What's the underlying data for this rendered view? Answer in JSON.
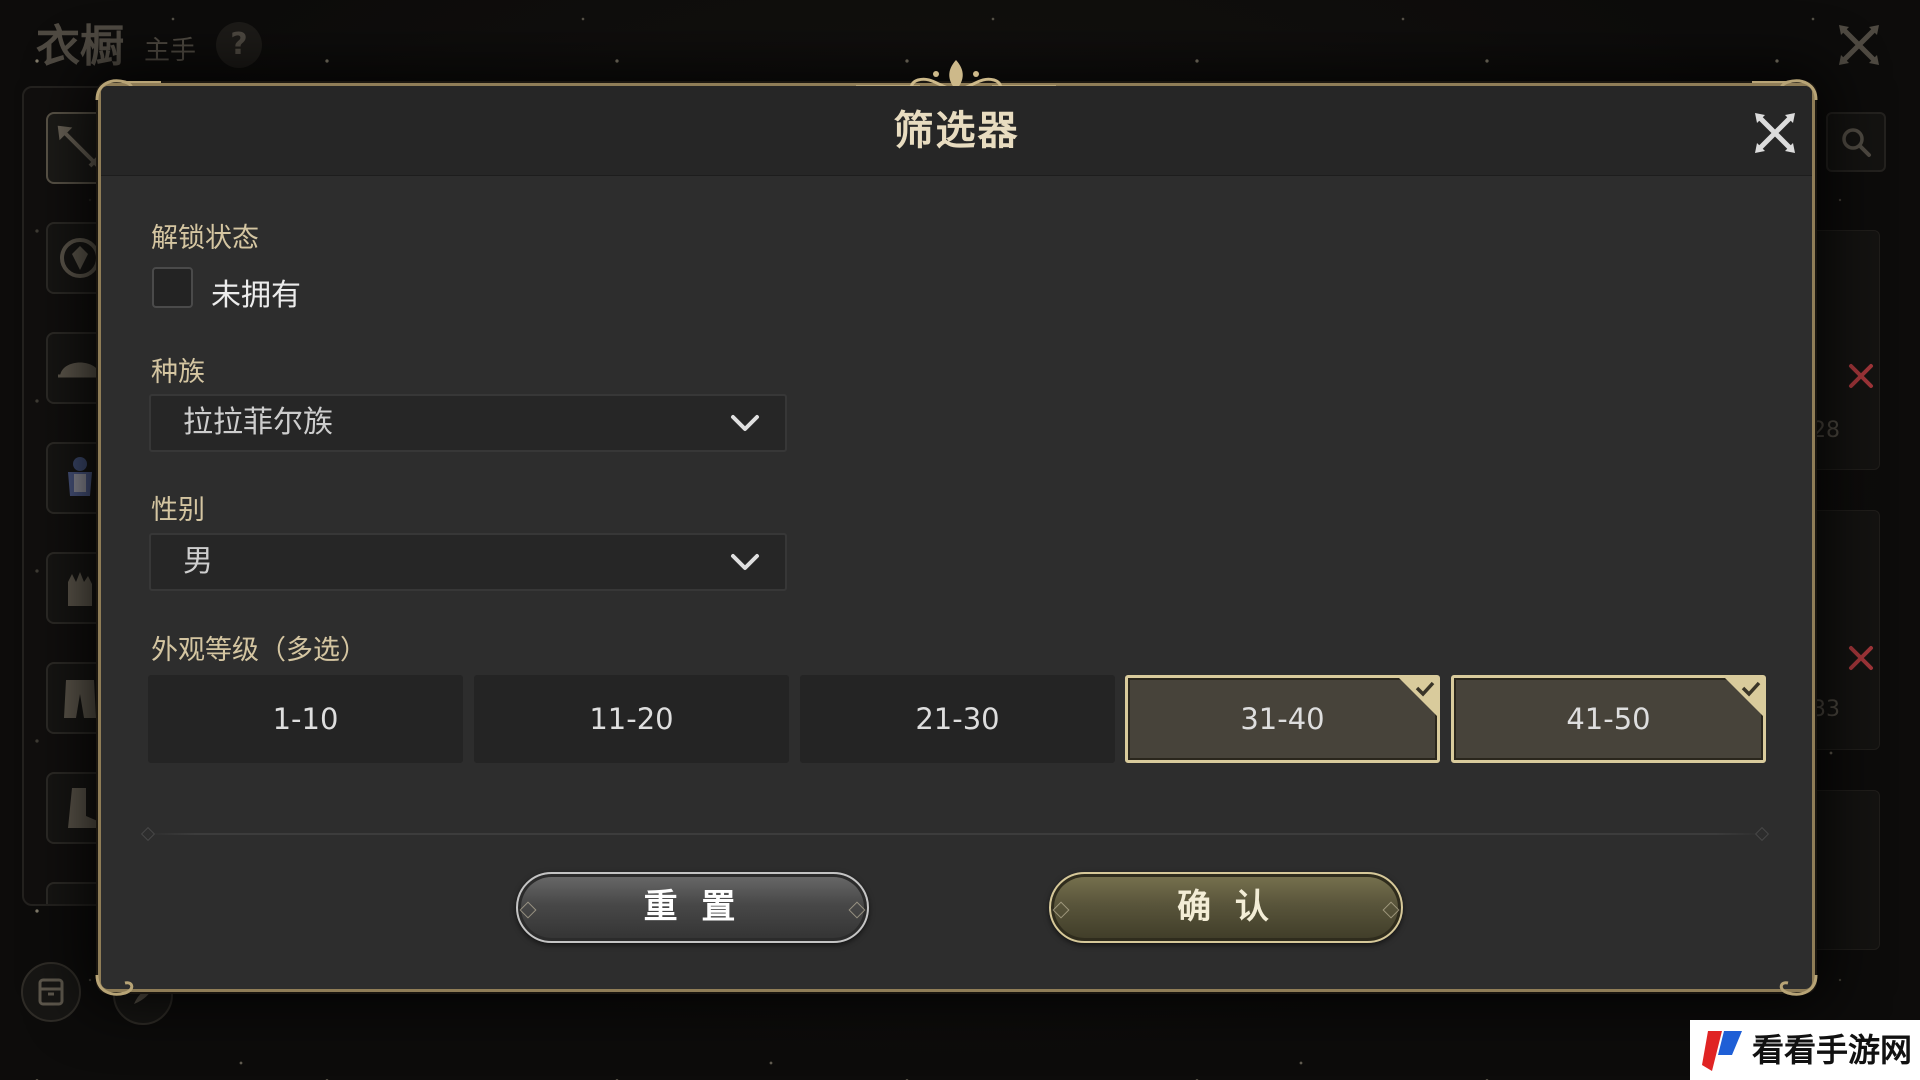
{
  "app": {
    "title": "衣橱",
    "subtitle": "主手",
    "help_label": "?"
  },
  "side_list": {
    "counts": [
      "28",
      "33"
    ]
  },
  "filter_dialog": {
    "title": "筛选器",
    "unlock_status": {
      "label": "解锁状态",
      "option_label": "未拥有",
      "checked": false
    },
    "race": {
      "label": "种族",
      "selected": "拉拉菲尔族"
    },
    "gender": {
      "label": "性别",
      "selected": "男"
    },
    "appearance_level": {
      "label": "外观等级（多选）",
      "options": [
        {
          "label": "1-10",
          "selected": false
        },
        {
          "label": "11-20",
          "selected": false
        },
        {
          "label": "21-30",
          "selected": false
        },
        {
          "label": "31-40",
          "selected": true
        },
        {
          "label": "41-50",
          "selected": true
        }
      ]
    },
    "buttons": {
      "reset": "重 置",
      "confirm": "确 认"
    }
  },
  "watermark": {
    "text": "看看手游网"
  },
  "icons": {
    "help": "help-icon",
    "window_close": "close-icon",
    "dialog_close": "close-icon",
    "search": "search-icon",
    "remove": "remove-x-icon",
    "dropdown": "chevron-down-icon",
    "selected_check": "check-icon",
    "sidebar_slots": [
      "weapon-slot-icon",
      "shield-slot-icon",
      "head-slot-icon",
      "body-slot-icon",
      "hands-slot-icon",
      "legs-slot-icon",
      "feet-slot-icon",
      "accessory-slot-icon"
    ],
    "bottom": [
      "wardrobe-icon",
      "dye-icon"
    ]
  },
  "colors": {
    "label_gold": "#d4c5a1",
    "selected_border": "#d9cb9c",
    "selected_fill": "#47433a",
    "remove_mark": "#a3363a",
    "frame_gold": "#8f7d57"
  }
}
